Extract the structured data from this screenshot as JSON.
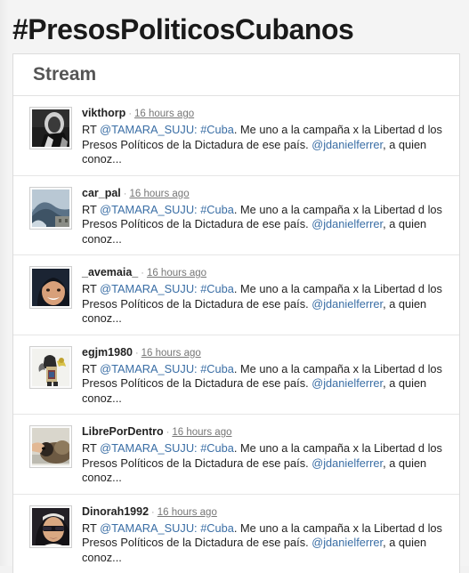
{
  "page": {
    "title": "#PresosPoliticosCubanos",
    "accent_link_color": "#3a6ea5",
    "background_color": "#f4f4f4"
  },
  "card": {
    "header_title": "Stream"
  },
  "tweet_template": {
    "prefix": "RT ",
    "mention_source": "@TAMARA_SUJU:",
    "hashtag": "#Cuba",
    "body_part_1": ". Me uno a la campaña x la Libertad d los Presos Políticos de la Dictadura de ese país. ",
    "mention_target": "@jdanielferrer",
    "body_part_2": ", a quien conoz..."
  },
  "stream": {
    "items": [
      {
        "username": "vikthorp",
        "separator": "·",
        "timestamp": "16 hours ago",
        "avatar": "dark-portrait-avatar"
      },
      {
        "username": "car_pal",
        "separator": "·",
        "timestamp": "16 hours ago",
        "avatar": "seascape-avatar"
      },
      {
        "username": "_avemaia_",
        "separator": "·",
        "timestamp": "16 hours ago",
        "avatar": "smiling-woman-avatar"
      },
      {
        "username": "egjm1980",
        "separator": "·",
        "timestamp": "16 hours ago",
        "avatar": "colorful-figure-avatar"
      },
      {
        "username": "LibrePorDentro",
        "separator": "·",
        "timestamp": "16 hours ago",
        "avatar": "pet-photo-avatar"
      },
      {
        "username": "Dinorah1992",
        "separator": "·",
        "timestamp": "16 hours ago",
        "avatar": "sunglasses-woman-avatar"
      }
    ]
  }
}
